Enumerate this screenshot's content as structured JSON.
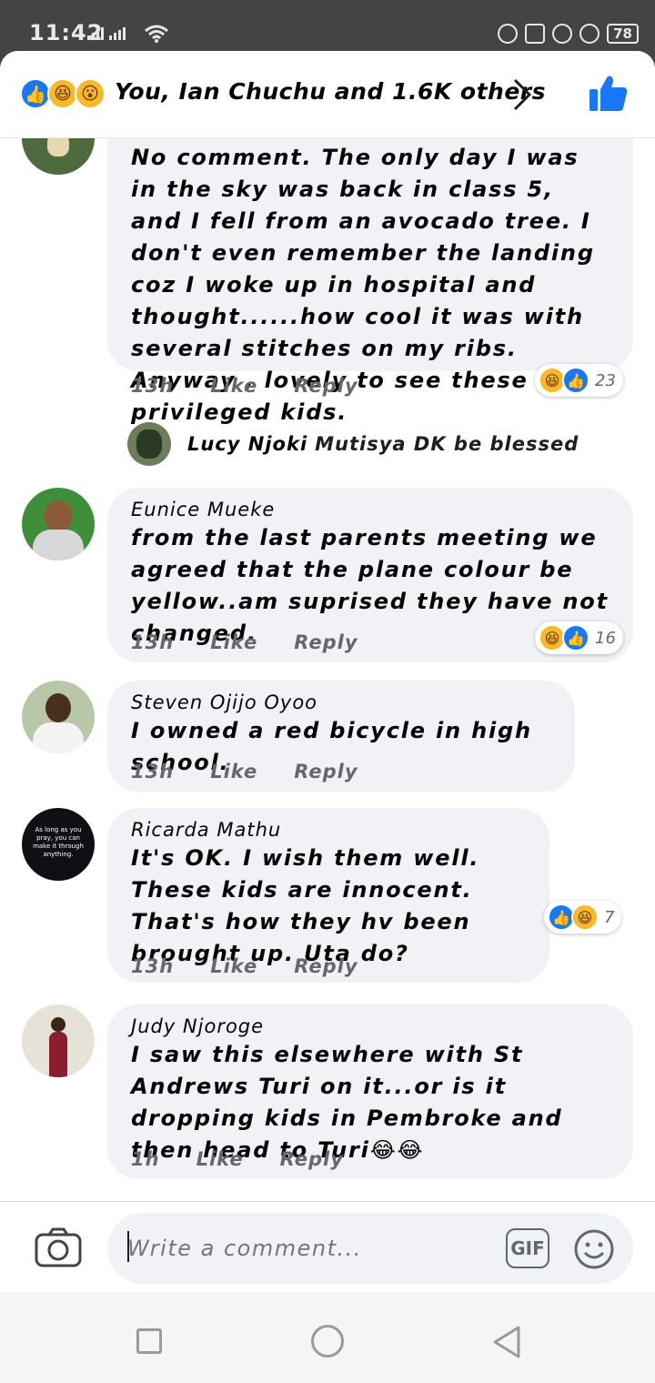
{
  "status_bar": {
    "time": "11:42",
    "battery": "78"
  },
  "header": {
    "reaction_icons": [
      "like-icon",
      "haha-icon",
      "wow-icon"
    ],
    "summary": "You, Ian Chuchu and 1.6K others"
  },
  "comments": [
    {
      "author": "",
      "text": "No comment.  The only day I was in the sky was back in class 5, and I fell from an avocado tree. I don't even remember the landing coz I woke up in hospital and thought......how cool it was with several stitches on my ribs. Anyway , lovely to see these  privileged kids.",
      "time": "13h",
      "like": "Like",
      "reply": "Reply",
      "reaction_count": "23"
    },
    {
      "author": "Eunice Mueke",
      "text": "from the last parents meeting we agreed that the plane colour be yellow..am suprised they have not changed.",
      "time": "13h",
      "like": "Like",
      "reply": "Reply",
      "reaction_count": "16"
    },
    {
      "author": "Steven Ojijo Oyoo",
      "text": "I owned a red bicycle in high school.",
      "time": "13h",
      "like": "Like",
      "reply": "Reply"
    },
    {
      "author": "Ricarda Mathu",
      "text": "It's OK. I wish them well. These kids are innocent. That's how they hv been brought up. Uta do?",
      "time": "13h",
      "like": "Like",
      "reply": "Reply",
      "reaction_count": "7",
      "avatar_text": "As long as you pray, you can make it through anything."
    },
    {
      "author": "Judy Njoroge",
      "text": "I saw this elsewhere with St Andrews Turi on it...or is it dropping kids in Pembroke and then head to Turi😂😂",
      "time": "1h",
      "like": "Like",
      "reply": "Reply"
    }
  ],
  "reply_preview": {
    "name": "Lucy Njoki",
    "text": "Mutisya DK be blessed"
  },
  "composer": {
    "placeholder": "Write a comment...",
    "gif_label": "GIF"
  },
  "colors": {
    "accent": "#1877f2",
    "bubble": "#f0f2f5",
    "haha": "#f7b928"
  }
}
